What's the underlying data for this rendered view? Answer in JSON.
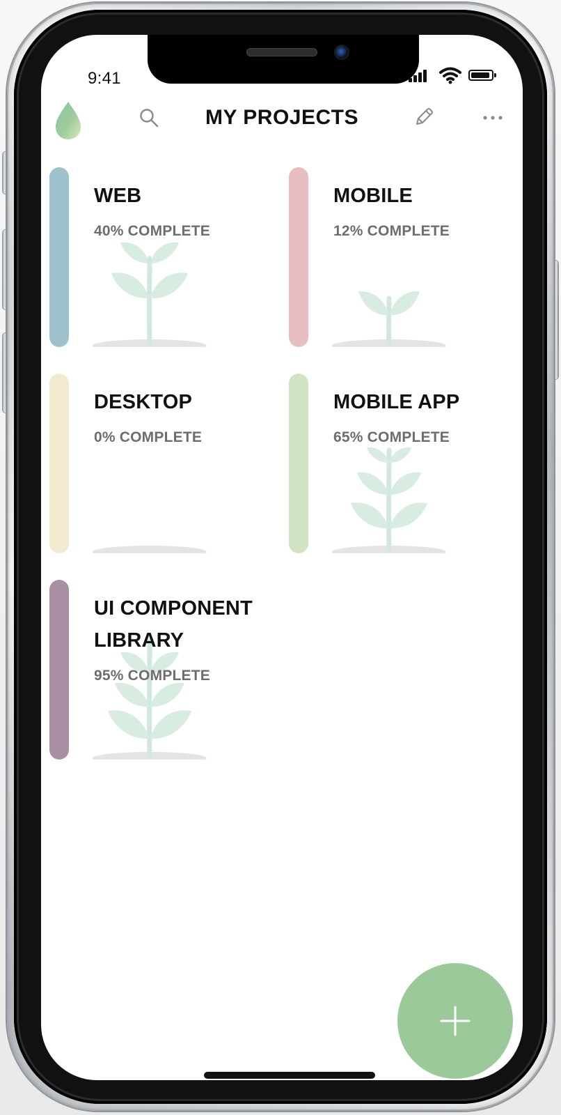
{
  "status_bar": {
    "time": "9:41"
  },
  "header": {
    "title": "MY PROJECTS",
    "logo_icon": "water-drop-icon",
    "search_icon": "search-icon",
    "edit_icon": "pencil-icon",
    "more_icon": "more-icon"
  },
  "projects": [
    {
      "title": "WEB",
      "progress_text": "40% COMPLETE",
      "progress": 40,
      "color": "#9fc1cb"
    },
    {
      "title": "MOBILE",
      "progress_text": "12% COMPLETE",
      "progress": 12,
      "color": "#e9bec3"
    },
    {
      "title": "DESKTOP",
      "progress_text": "0% COMPLETE",
      "progress": 0,
      "color": "#f2ebcf"
    },
    {
      "title": "MOBILE APP",
      "progress_text": "65% COMPLETE",
      "progress": 65,
      "color": "#d2e3c4"
    },
    {
      "title": "UI COMPONENT\nLIBRARY",
      "progress_text": "95% COMPLETE",
      "progress": 95,
      "color": "#a88fa4"
    }
  ],
  "fab": {
    "icon": "plus-icon",
    "color": "#9cc99a"
  },
  "theme": {
    "text_primary": "#111111",
    "text_secondary": "#6d6d6d",
    "plant_leaf": "#d9ece2",
    "plant_stem": "#d2e7df",
    "ground": "#e4e4e4"
  }
}
